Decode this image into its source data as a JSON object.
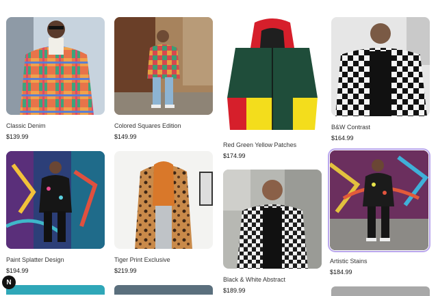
{
  "products": [
    {
      "name": "Classic Denim",
      "price": "$139.99",
      "image": "plaid-jacket-photo"
    },
    {
      "name": "Colored Squares Edition",
      "price": "$149.99",
      "image": "street-plaid-photo"
    },
    {
      "name": "Red Green Yellow Patches",
      "price": "$174.99",
      "image": "colorblock-hooded-jacket-photo"
    },
    {
      "name": "B&W Contrast",
      "price": "$164.99",
      "image": "checkered-jacket-photo"
    },
    {
      "name": "Paint Splatter Design",
      "price": "$194.99",
      "image": "graffiti-jacket-photo"
    },
    {
      "name": "Tiger Print Exclusive",
      "price": "$219.99",
      "image": "leopard-coat-photo"
    },
    {
      "name": "Black & White Abstract",
      "price": "$189.99",
      "image": "bw-plaid-shirt-photo"
    },
    {
      "name": "Artistic Stains",
      "price": "$184.99",
      "image": "graffiti-wall-photo"
    }
  ],
  "badge": {
    "letter": "N"
  },
  "colors": {
    "selected_outline": "#b9a6ec"
  }
}
